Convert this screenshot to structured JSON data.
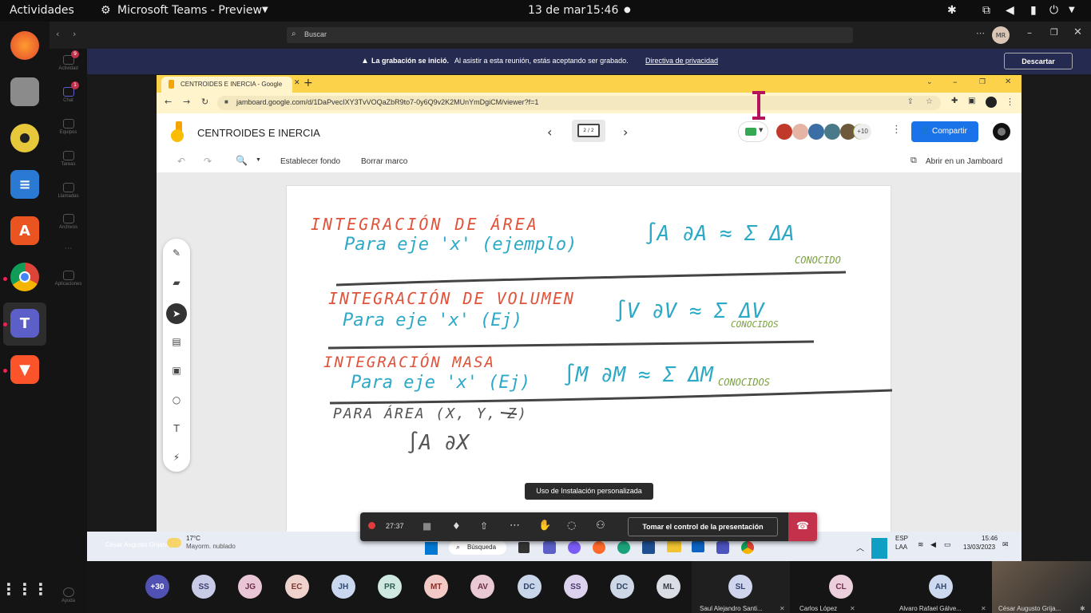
{
  "topbar": {
    "activities": "Actividades",
    "app_name": "Microsoft Teams - Preview",
    "date": "13 de mar",
    "time": "15:46"
  },
  "teams": {
    "search_placeholder": "Buscar",
    "user_initials": "MR",
    "rail": [
      {
        "label": "Actividad",
        "badge": "9"
      },
      {
        "label": "Chat",
        "badge": "1"
      },
      {
        "label": "Equipos",
        "badge": ""
      },
      {
        "label": "Tareas",
        "badge": ""
      },
      {
        "label": "Llamadas",
        "badge": ""
      },
      {
        "label": "Archivos",
        "badge": ""
      },
      {
        "label": "Aplicaciones",
        "badge": ""
      },
      {
        "label": "Ayuda",
        "badge": ""
      }
    ],
    "banner": {
      "bold": "La grabación se inició.",
      "text": "Al asistir a esta reunión, estás aceptando ser grabado.",
      "link": "Directiva de privacidad",
      "dismiss": "Descartar"
    }
  },
  "browser": {
    "tab_title": "CENTROIDES E INERCIA - Google",
    "url": "jamboard.google.com/d/1DaPvecIXY3TvVOQaZbR9to7-0y6Q9v2K2MUnYmDgiCM/viewer?f=1"
  },
  "jamboard": {
    "title": "CENTROIDES E INERCIA",
    "frame": "2 / 2",
    "extra_collaborators": "+10",
    "share": "Compartir",
    "set_background": "Establecer fondo",
    "clear_frame": "Borrar marco",
    "open_in_jamboard": "Abrir en un Jamboard"
  },
  "handwriting": {
    "l1_title": "INTEGRACIÓN DE ÁREA",
    "l1_sub": "Para eje 'x' (ejemplo)",
    "l1_formula": "∫A ∂A ≈ Σ ΔA",
    "l1_note": "CONOCIDO",
    "l2_title": "INTEGRACIÓN DE VOLUMEN",
    "l2_sub": "Para eje 'x' (Ej)",
    "l2_formula": "∫V ∂V ≈ Σ ΔV",
    "l2_note": "CONOCIDOS",
    "l3_title": "INTEGRACIÓN MASA",
    "l3_sub": "Para eje 'x' (Ej)",
    "l3_formula": "∫M ∂M ≈ Σ ΔM",
    "l3_note": "CONOCIDOS",
    "l4_title": "PARA ÁREA (X, Y, Z)",
    "l4_formula": "∫A ∂X"
  },
  "windows_taskbar": {
    "presenter": "César Augusto Grijalva",
    "temp": "17°C",
    "weather": "Mayorm. nublado",
    "search": "Búsqueda",
    "lang1": "ESP",
    "lang2": "LAA",
    "clock_time": "15:46",
    "clock_date": "13/03/2023"
  },
  "call": {
    "tooltip": "Uso de Instalación personalizada",
    "timer": "27:37",
    "take_control": "Tomar el control de la presentación"
  },
  "participants": [
    {
      "initials": "+30",
      "color": "#4f52b2",
      "text": "#ffffff"
    },
    {
      "initials": "SS",
      "color": "#c8cbe6",
      "text": "#3a3d6e"
    },
    {
      "initials": "JG",
      "color": "#e9c6d6",
      "text": "#6e2f4a"
    },
    {
      "initials": "EC",
      "color": "#f0d2cc",
      "text": "#7a3a30"
    },
    {
      "initials": "JH",
      "color": "#c9d8ee",
      "text": "#2f4a70"
    },
    {
      "initials": "PR",
      "color": "#cfe8e2",
      "text": "#2e5c52"
    },
    {
      "initials": "MT",
      "color": "#f2c9c4",
      "text": "#8a2f28"
    },
    {
      "initials": "AV",
      "color": "#e9c9d3",
      "text": "#6b2f44"
    },
    {
      "initials": "DC",
      "color": "#c9d6ea",
      "text": "#2f4266"
    },
    {
      "initials": "SS",
      "color": "#dcd2ee",
      "text": "#4a3a70"
    },
    {
      "initials": "DC",
      "color": "#cdd7e6",
      "text": "#2f4266"
    },
    {
      "initials": "ML",
      "color": "#dadde4",
      "text": "#3a3f4a"
    }
  ],
  "named_participants": [
    {
      "initials": "SL",
      "name": "Saul Alejandro Santi...",
      "color": "#cfd5ec",
      "text": "#33406b"
    },
    {
      "initials": "CL",
      "name": "Carlos López",
      "color": "#eccfdc",
      "text": "#6e2f4a"
    },
    {
      "initials": "AH",
      "name": "Alvaro Rafael Gálve...",
      "color": "#cdd9ee",
      "text": "#2f4870"
    },
    {
      "name": "César Augusto Grija..."
    }
  ]
}
